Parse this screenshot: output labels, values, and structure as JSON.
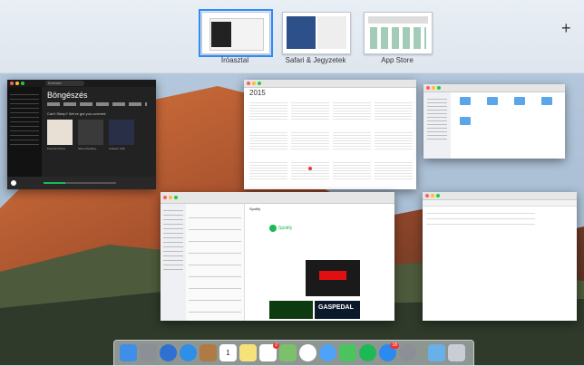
{
  "spaces": [
    {
      "label": "Íróasztal",
      "active": true
    },
    {
      "label": "Safari & Jegyzetek",
      "active": false
    },
    {
      "label": "App Store",
      "active": false
    }
  ],
  "add_space_label": "+",
  "spotify": {
    "heading": "Böngészés",
    "search_placeholder": "Keresés",
    "subheading": "Can't Sleep? We've got you covered.",
    "tiles": [
      "Peaceful Piano",
      "Sleep Reading",
      "Ambient Chill"
    ]
  },
  "calendar": {
    "year": "2015"
  },
  "mail": {
    "sender_title": "Spotify",
    "brand": "Spotify",
    "image_caption": "GASPEDAL"
  },
  "dock": {
    "icons": [
      "finder-icon",
      "launchpad-icon",
      "rocket-icon",
      "safari-icon",
      "contacts-icon",
      "calendar-icon",
      "notes-icon",
      "reminders-icon",
      "maps-icon",
      "photos-icon",
      "messages-icon",
      "facetime-icon",
      "spotify-icon",
      "app-store-icon",
      "system-preferences-icon",
      "downloads-folder-icon",
      "trash-icon"
    ],
    "reminders_badge": "2",
    "calendar_day": "1",
    "app_store_badge": "18"
  },
  "colors": {
    "accent": "#2b8cff",
    "spotify_green": "#1db954"
  }
}
